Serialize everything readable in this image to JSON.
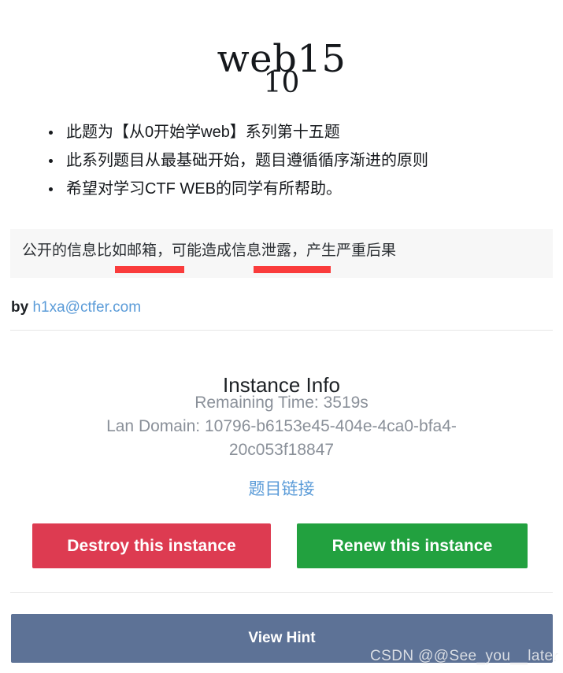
{
  "challenge": {
    "title": "web15",
    "score": "10",
    "description_items": [
      "此题为【从0开始学web】系列第十五题",
      "此系列题目从最基础开始，题目遵循循序渐进的原则",
      "希望对学习CTF WEB的同学有所帮助。"
    ],
    "hint_paragraph": "公开的信息比如邮箱，可能造成信息泄露，产生严重后果",
    "author_prefix": "by",
    "author_email": "h1xa@ctfer.com"
  },
  "instance": {
    "heading": "Instance Info",
    "remaining_time": "Remaining Time: 3519s",
    "lan_domain": "Lan Domain: 10796-b6153e45-404e-4ca0-bfa4-20c053f18847",
    "link_label": "题目链接"
  },
  "actions": {
    "destroy_label": "Destroy this instance",
    "renew_label": "Renew this instance",
    "view_hint_label": "View Hint"
  },
  "watermark": {
    "text": "CSDN @@See_you__later"
  },
  "colors": {
    "destroy": "#dd3b51",
    "renew": "#22a13f",
    "view_hint": "#5d7296",
    "link": "#5a9bd8",
    "redact": "#fa3c3c",
    "hint_background": "#f7f7f7",
    "muted_text": "#8a9099"
  }
}
